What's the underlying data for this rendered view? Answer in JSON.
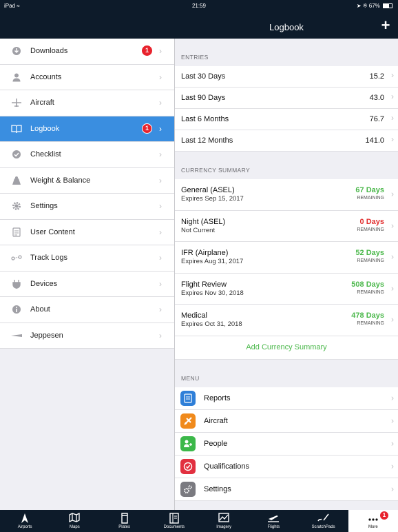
{
  "status": {
    "carrier": "iPad",
    "time": "21:59",
    "battery": "67%"
  },
  "navbar": {
    "title": "Logbook"
  },
  "sidebar": {
    "items": [
      {
        "label": "Downloads",
        "badge": "1"
      },
      {
        "label": "Accounts"
      },
      {
        "label": "Aircraft"
      },
      {
        "label": "Logbook",
        "badge": "1",
        "active": true
      },
      {
        "label": "Checklist"
      },
      {
        "label": "Weight & Balance"
      },
      {
        "label": "Settings"
      },
      {
        "label": "User Content"
      },
      {
        "label": "Track Logs"
      },
      {
        "label": "Devices"
      },
      {
        "label": "About"
      },
      {
        "label": "Jeppesen"
      }
    ]
  },
  "entries": {
    "header": "ENTRIES",
    "rows": [
      {
        "label": "Last 30 Days",
        "value": "15.2"
      },
      {
        "label": "Last 90 Days",
        "value": "43.0"
      },
      {
        "label": "Last 6 Months",
        "value": "76.7"
      },
      {
        "label": "Last 12 Months",
        "value": "141.0"
      }
    ]
  },
  "currency": {
    "header": "CURRENCY SUMMARY",
    "rows": [
      {
        "name": "General (ASEL)",
        "sub": "Expires Sep 15, 2017",
        "days": "67 Days",
        "remaining": "REMAINING",
        "status": "green"
      },
      {
        "name": "Night (ASEL)",
        "sub": "Not Current",
        "days": "0 Days",
        "remaining": "REMAINING",
        "status": "red"
      },
      {
        "name": "IFR (Airplane)",
        "sub": "Expires Aug 31, 2017",
        "days": "52 Days",
        "remaining": "REMAINING",
        "status": "green"
      },
      {
        "name": "Flight Review",
        "sub": "Expires Nov 30, 2018",
        "days": "508 Days",
        "remaining": "REMAINING",
        "status": "green"
      },
      {
        "name": "Medical",
        "sub": "Expires Oct 31, 2018",
        "days": "478 Days",
        "remaining": "REMAINING",
        "status": "green"
      }
    ],
    "add_label": "Add Currency Summary"
  },
  "menu": {
    "header": "MENU",
    "items": [
      {
        "label": "Reports",
        "color": "#2f7fd8"
      },
      {
        "label": "Aircraft",
        "color": "#f08a1c"
      },
      {
        "label": "People",
        "color": "#3cb84a"
      },
      {
        "label": "Qualifications",
        "color": "#e23040"
      },
      {
        "label": "Settings",
        "color": "#7a7a80"
      }
    ]
  },
  "tabbar": {
    "tabs": [
      {
        "label": "Airports"
      },
      {
        "label": "Maps"
      },
      {
        "label": "Plates"
      },
      {
        "label": "Documents"
      },
      {
        "label": "Imagery"
      },
      {
        "label": "Flights"
      },
      {
        "label": "ScratchPads"
      },
      {
        "label": "More",
        "badge": "1",
        "active": true
      }
    ]
  },
  "colors": {
    "accent": "#3a8ee0",
    "bar": "#0d1b2a",
    "green": "#4bb84b",
    "red": "#e23030",
    "badge": "#e8232d"
  }
}
